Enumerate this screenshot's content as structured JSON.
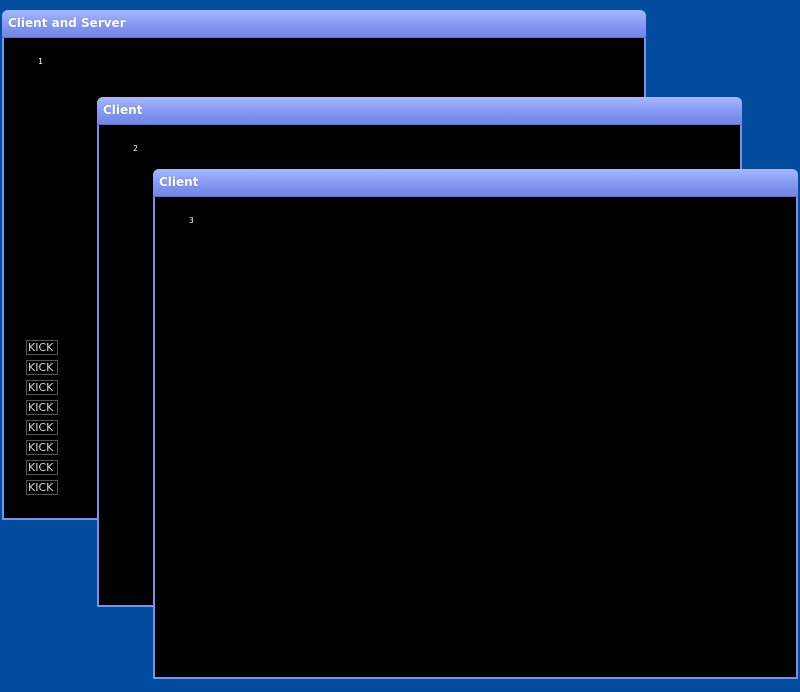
{
  "windows": [
    {
      "title": "Client and Server",
      "player_number": "1"
    },
    {
      "title": "Client",
      "player_number": "2"
    },
    {
      "title": "Client",
      "player_number": "3"
    }
  ],
  "kick_buttons": [
    "KICK",
    "KICK",
    "KICK",
    "KICK",
    "KICK",
    "KICK",
    "KICK",
    "KICK"
  ],
  "colors": {
    "desktop": "#034da0",
    "titlebar": "#8fa3f8",
    "window_border": "#7a8ff0",
    "content": "#000000"
  }
}
